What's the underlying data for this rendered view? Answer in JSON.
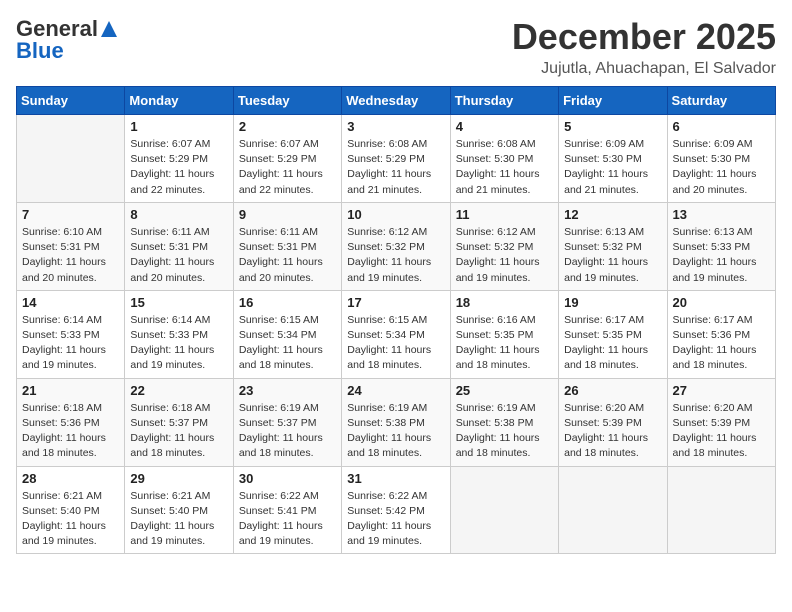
{
  "logo": {
    "general": "General",
    "blue": "Blue"
  },
  "title": "December 2025",
  "subtitle": "Jujutla, Ahuachapan, El Salvador",
  "days_of_week": [
    "Sunday",
    "Monday",
    "Tuesday",
    "Wednesday",
    "Thursday",
    "Friday",
    "Saturday"
  ],
  "weeks": [
    [
      {
        "day": "",
        "info": ""
      },
      {
        "day": "1",
        "info": "Sunrise: 6:07 AM\nSunset: 5:29 PM\nDaylight: 11 hours\nand 22 minutes."
      },
      {
        "day": "2",
        "info": "Sunrise: 6:07 AM\nSunset: 5:29 PM\nDaylight: 11 hours\nand 22 minutes."
      },
      {
        "day": "3",
        "info": "Sunrise: 6:08 AM\nSunset: 5:29 PM\nDaylight: 11 hours\nand 21 minutes."
      },
      {
        "day": "4",
        "info": "Sunrise: 6:08 AM\nSunset: 5:30 PM\nDaylight: 11 hours\nand 21 minutes."
      },
      {
        "day": "5",
        "info": "Sunrise: 6:09 AM\nSunset: 5:30 PM\nDaylight: 11 hours\nand 21 minutes."
      },
      {
        "day": "6",
        "info": "Sunrise: 6:09 AM\nSunset: 5:30 PM\nDaylight: 11 hours\nand 20 minutes."
      }
    ],
    [
      {
        "day": "7",
        "info": "Sunrise: 6:10 AM\nSunset: 5:31 PM\nDaylight: 11 hours\nand 20 minutes."
      },
      {
        "day": "8",
        "info": "Sunrise: 6:11 AM\nSunset: 5:31 PM\nDaylight: 11 hours\nand 20 minutes."
      },
      {
        "day": "9",
        "info": "Sunrise: 6:11 AM\nSunset: 5:31 PM\nDaylight: 11 hours\nand 20 minutes."
      },
      {
        "day": "10",
        "info": "Sunrise: 6:12 AM\nSunset: 5:32 PM\nDaylight: 11 hours\nand 19 minutes."
      },
      {
        "day": "11",
        "info": "Sunrise: 6:12 AM\nSunset: 5:32 PM\nDaylight: 11 hours\nand 19 minutes."
      },
      {
        "day": "12",
        "info": "Sunrise: 6:13 AM\nSunset: 5:32 PM\nDaylight: 11 hours\nand 19 minutes."
      },
      {
        "day": "13",
        "info": "Sunrise: 6:13 AM\nSunset: 5:33 PM\nDaylight: 11 hours\nand 19 minutes."
      }
    ],
    [
      {
        "day": "14",
        "info": "Sunrise: 6:14 AM\nSunset: 5:33 PM\nDaylight: 11 hours\nand 19 minutes."
      },
      {
        "day": "15",
        "info": "Sunrise: 6:14 AM\nSunset: 5:33 PM\nDaylight: 11 hours\nand 19 minutes."
      },
      {
        "day": "16",
        "info": "Sunrise: 6:15 AM\nSunset: 5:34 PM\nDaylight: 11 hours\nand 18 minutes."
      },
      {
        "day": "17",
        "info": "Sunrise: 6:15 AM\nSunset: 5:34 PM\nDaylight: 11 hours\nand 18 minutes."
      },
      {
        "day": "18",
        "info": "Sunrise: 6:16 AM\nSunset: 5:35 PM\nDaylight: 11 hours\nand 18 minutes."
      },
      {
        "day": "19",
        "info": "Sunrise: 6:17 AM\nSunset: 5:35 PM\nDaylight: 11 hours\nand 18 minutes."
      },
      {
        "day": "20",
        "info": "Sunrise: 6:17 AM\nSunset: 5:36 PM\nDaylight: 11 hours\nand 18 minutes."
      }
    ],
    [
      {
        "day": "21",
        "info": "Sunrise: 6:18 AM\nSunset: 5:36 PM\nDaylight: 11 hours\nand 18 minutes."
      },
      {
        "day": "22",
        "info": "Sunrise: 6:18 AM\nSunset: 5:37 PM\nDaylight: 11 hours\nand 18 minutes."
      },
      {
        "day": "23",
        "info": "Sunrise: 6:19 AM\nSunset: 5:37 PM\nDaylight: 11 hours\nand 18 minutes."
      },
      {
        "day": "24",
        "info": "Sunrise: 6:19 AM\nSunset: 5:38 PM\nDaylight: 11 hours\nand 18 minutes."
      },
      {
        "day": "25",
        "info": "Sunrise: 6:19 AM\nSunset: 5:38 PM\nDaylight: 11 hours\nand 18 minutes."
      },
      {
        "day": "26",
        "info": "Sunrise: 6:20 AM\nSunset: 5:39 PM\nDaylight: 11 hours\nand 18 minutes."
      },
      {
        "day": "27",
        "info": "Sunrise: 6:20 AM\nSunset: 5:39 PM\nDaylight: 11 hours\nand 18 minutes."
      }
    ],
    [
      {
        "day": "28",
        "info": "Sunrise: 6:21 AM\nSunset: 5:40 PM\nDaylight: 11 hours\nand 19 minutes."
      },
      {
        "day": "29",
        "info": "Sunrise: 6:21 AM\nSunset: 5:40 PM\nDaylight: 11 hours\nand 19 minutes."
      },
      {
        "day": "30",
        "info": "Sunrise: 6:22 AM\nSunset: 5:41 PM\nDaylight: 11 hours\nand 19 minutes."
      },
      {
        "day": "31",
        "info": "Sunrise: 6:22 AM\nSunset: 5:42 PM\nDaylight: 11 hours\nand 19 minutes."
      },
      {
        "day": "",
        "info": ""
      },
      {
        "day": "",
        "info": ""
      },
      {
        "day": "",
        "info": ""
      }
    ]
  ]
}
